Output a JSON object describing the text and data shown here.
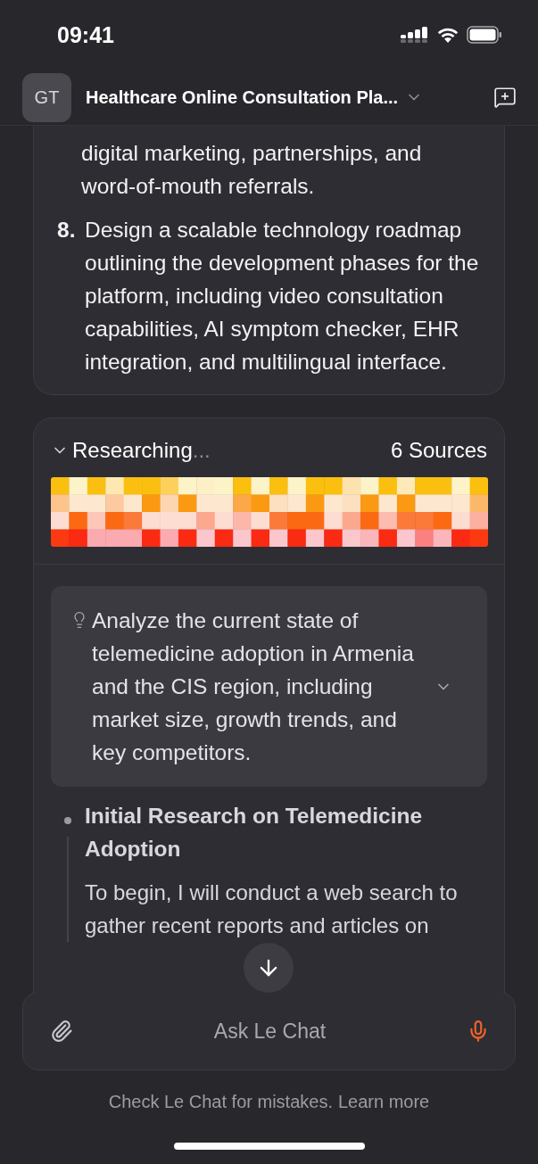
{
  "status_bar": {
    "time": "09:41"
  },
  "header": {
    "avatar": "GT",
    "title": "Healthcare Online Consultation Pla..."
  },
  "plan_card": {
    "continuation": "digital marketing, partnerships, and word-of-mouth referrals.",
    "steps": [
      {
        "number": "8.",
        "text": "Design a scalable technology roadmap outlining the development phases for the platform, including video consultation capabilities, AI symptom checker, EHR integration, and multilingual interface."
      }
    ]
  },
  "research": {
    "expanded": true,
    "status": "Researching",
    "ellipsis": "...",
    "sources": "6 Sources",
    "query": {
      "text": "Analyze the current state of telemedicine adoption in Armenia and the CIS region, including market size, growth trends, and key competitors.",
      "expanded": false
    },
    "steps": [
      {
        "title": "Initial Research on Telemedicine Adoption",
        "text": "To begin, I will conduct a web search to gather recent reports and articles on"
      }
    ]
  },
  "composer": {
    "placeholder": "Ask Le Chat"
  },
  "footer": {
    "text": "Check Le Chat for mistakes.",
    "link": "Learn more"
  }
}
